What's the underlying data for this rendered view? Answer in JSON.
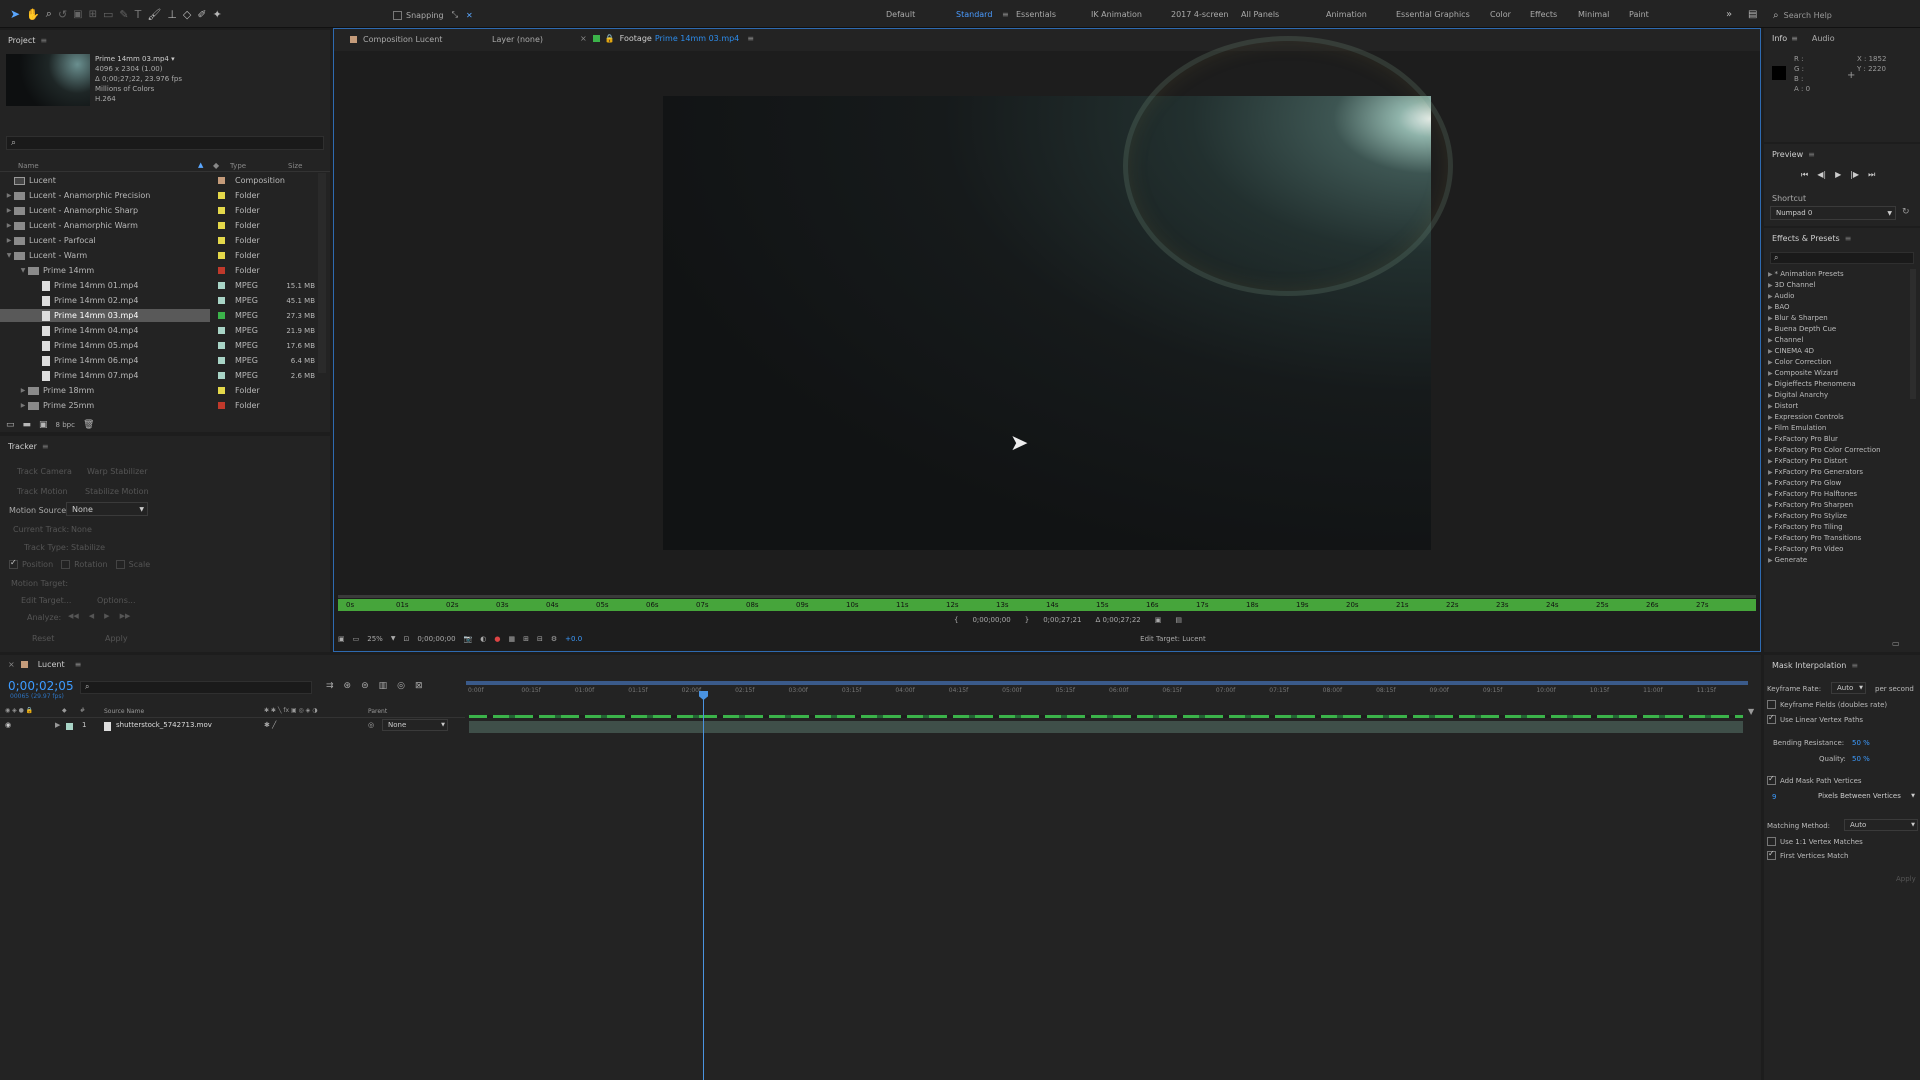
{
  "toolbar": {
    "snapping_label": "Snapping",
    "workspaces": [
      "Default",
      "Standard",
      "Essentials",
      "IK Animation",
      "2017 4-screen",
      "All Panels",
      "Animation",
      "Essential Graphics",
      "Color",
      "Effects",
      "Minimal",
      "Paint"
    ],
    "active_workspace": "Standard",
    "search_placeholder": "Search Help"
  },
  "project": {
    "title": "Project",
    "footage": {
      "name": "Prime 14mm 03.mp4 ▾",
      "dimensions": "4096 x 2304 (1.00)",
      "duration": "Δ 0;00;27;22, 23.976 fps",
      "colors": "Millions of Colors",
      "codec": "H.264"
    },
    "columns": {
      "name": "Name",
      "type": "Type",
      "size": "Size"
    },
    "items": [
      {
        "indent": 0,
        "tri": "",
        "label": "Lucent",
        "color": "#c49b7a",
        "type": "Composition",
        "size": "",
        "kind": "comp"
      },
      {
        "indent": 0,
        "tri": "▶",
        "label": "Lucent - Anamorphic Precision",
        "color": "#e4d84a",
        "type": "Folder",
        "size": "",
        "kind": "folder"
      },
      {
        "indent": 0,
        "tri": "▶",
        "label": "Lucent - Anamorphic Sharp",
        "color": "#e4d84a",
        "type": "Folder",
        "size": "",
        "kind": "folder"
      },
      {
        "indent": 0,
        "tri": "▶",
        "label": "Lucent - Anamorphic Warm",
        "color": "#e4d84a",
        "type": "Folder",
        "size": "",
        "kind": "folder"
      },
      {
        "indent": 0,
        "tri": "▶",
        "label": "Lucent - Parfocal",
        "color": "#e4d84a",
        "type": "Folder",
        "size": "",
        "kind": "folder"
      },
      {
        "indent": 0,
        "tri": "▼",
        "label": "Lucent - Warm",
        "color": "#e4d84a",
        "type": "Folder",
        "size": "",
        "kind": "folder"
      },
      {
        "indent": 1,
        "tri": "▼",
        "label": "Prime 14mm",
        "color": "#c0392b",
        "type": "Folder",
        "size": "",
        "kind": "folder"
      },
      {
        "indent": 2,
        "tri": "",
        "label": "Prime 14mm 01.mp4",
        "color": "#a8d4c6",
        "type": "MPEG",
        "size": "15.1 MB",
        "kind": "file"
      },
      {
        "indent": 2,
        "tri": "",
        "label": "Prime 14mm 02.mp4",
        "color": "#a8d4c6",
        "type": "MPEG",
        "size": "45.1 MB",
        "kind": "file"
      },
      {
        "indent": 2,
        "tri": "",
        "label": "Prime 14mm 03.mp4",
        "color": "#3bb34a",
        "type": "MPEG",
        "size": "27.3 MB",
        "kind": "file",
        "selected": true
      },
      {
        "indent": 2,
        "tri": "",
        "label": "Prime 14mm 04.mp4",
        "color": "#a8d4c6",
        "type": "MPEG",
        "size": "21.9 MB",
        "kind": "file"
      },
      {
        "indent": 2,
        "tri": "",
        "label": "Prime 14mm 05.mp4",
        "color": "#a8d4c6",
        "type": "MPEG",
        "size": "17.6 MB",
        "kind": "file"
      },
      {
        "indent": 2,
        "tri": "",
        "label": "Prime 14mm 06.mp4",
        "color": "#a8d4c6",
        "type": "MPEG",
        "size": "6.4 MB",
        "kind": "file"
      },
      {
        "indent": 2,
        "tri": "",
        "label": "Prime 14mm 07.mp4",
        "color": "#a8d4c6",
        "type": "MPEG",
        "size": "2.6 MB",
        "kind": "file"
      },
      {
        "indent": 1,
        "tri": "▶",
        "label": "Prime 18mm",
        "color": "#e4d84a",
        "type": "Folder",
        "size": "",
        "kind": "folder"
      },
      {
        "indent": 1,
        "tri": "▶",
        "label": "Prime 25mm",
        "color": "#c0392b",
        "type": "Folder",
        "size": "",
        "kind": "folder"
      }
    ],
    "bpc": "8 bpc"
  },
  "tracker": {
    "title": "Tracker",
    "track_camera": "Track Camera",
    "warp_stabilizer": "Warp Stabilizer",
    "track_motion": "Track Motion",
    "stabilize_motion": "Stabilize Motion",
    "motion_source_label": "Motion Source:",
    "motion_source_value": "None",
    "current_track_label": "Current Track:",
    "current_track_value": "None",
    "track_type_label": "Track Type:",
    "track_type_value": "Stabilize",
    "position": "Position",
    "rotation": "Rotation",
    "scale": "Scale",
    "motion_target": "Motion Target:",
    "edit_target": "Edit Target...",
    "options": "Options...",
    "analyze": "Analyze:",
    "reset": "Reset",
    "apply": "Apply"
  },
  "viewer": {
    "tab_comp": "Composition Lucent",
    "tab_layer": "Layer (none)",
    "tab_footage_prefix": "Footage",
    "tab_footage_name": "Prime 14mm 03.mp4",
    "ruler_labels": [
      "0s",
      "01s",
      "02s",
      "03s",
      "04s",
      "05s",
      "06s",
      "07s",
      "08s",
      "09s",
      "10s",
      "11s",
      "12s",
      "13s",
      "14s",
      "15s",
      "16s",
      "17s",
      "18s",
      "19s",
      "20s",
      "21s",
      "22s",
      "23s",
      "24s",
      "25s",
      "26s",
      "27s"
    ],
    "in_point": "0;00;00;00",
    "out_point": "0;00;27;21",
    "duration": "Δ 0;00;27;22",
    "zoom": "25%",
    "current_time": "0;00;00;00",
    "exposure": "+0.0",
    "edit_target": "Edit Target: Lucent"
  },
  "info": {
    "tab_info": "Info",
    "tab_audio": "Audio",
    "r": "R :",
    "g": "G :",
    "b": "B :",
    "a": "A : 0",
    "x": "X : 1852",
    "y": "Y : 2220"
  },
  "preview": {
    "title": "Preview",
    "shortcut_label": "Shortcut",
    "shortcut_value": "Numpad 0"
  },
  "effects": {
    "title": "Effects & Presets",
    "items": [
      "* Animation Presets",
      "3D Channel",
      "Audio",
      "BAO",
      "Blur & Sharpen",
      "Buena Depth Cue",
      "Channel",
      "CINEMA 4D",
      "Color Correction",
      "Composite Wizard",
      "Digieffects Phenomena",
      "Digital Anarchy",
      "Distort",
      "Expression Controls",
      "Film Emulation",
      "FxFactory Pro Blur",
      "FxFactory Pro Color Correction",
      "FxFactory Pro Distort",
      "FxFactory Pro Generators",
      "FxFactory Pro Glow",
      "FxFactory Pro Halftones",
      "FxFactory Pro Sharpen",
      "FxFactory Pro Stylize",
      "FxFactory Pro Tiling",
      "FxFactory Pro Transitions",
      "FxFactory Pro Video",
      "Generate"
    ]
  },
  "timeline": {
    "comp_name": "Lucent",
    "timecode": "0;00;02;05",
    "fps": "00065 (29.97 fps)",
    "columns": {
      "source": "Source Name",
      "parent": "Parent"
    },
    "ruler": [
      "0:00f",
      "00:15f",
      "01:00f",
      "01:15f",
      "02:00f",
      "02:15f",
      "03:00f",
      "03:15f",
      "04:00f",
      "04:15f",
      "05:00f",
      "05:15f",
      "06:00f",
      "06:15f",
      "07:00f",
      "07:15f",
      "08:00f",
      "08:15f",
      "09:00f",
      "09:15f",
      "10:00f",
      "10:15f",
      "11:00f",
      "11:15f"
    ],
    "layers": [
      {
        "num": "1",
        "name": "shutterstock_5742713.mov",
        "parent": "None"
      }
    ]
  },
  "mask_interp": {
    "title": "Mask Interpolation",
    "keyframe_rate_label": "Keyframe Rate:",
    "keyframe_rate_value": "Auto",
    "per_second": "per second",
    "keyframe_fields": "Keyframe Fields (doubles rate)",
    "linear_vertex": "Use Linear Vertex Paths",
    "bending_label": "Bending Resistance:",
    "bending_value": "50 %",
    "quality_label": "Quality:",
    "quality_value": "50 %",
    "add_vertices": "Add Mask Path Vertices",
    "pixels_value": "9",
    "pixels_mode": "Pixels Between Vertices",
    "matching_label": "Matching Method:",
    "matching_value": "Auto",
    "use_11": "Use 1:1 Vertex Matches",
    "first_vertices": "First Vertices Match",
    "apply": "Apply"
  }
}
